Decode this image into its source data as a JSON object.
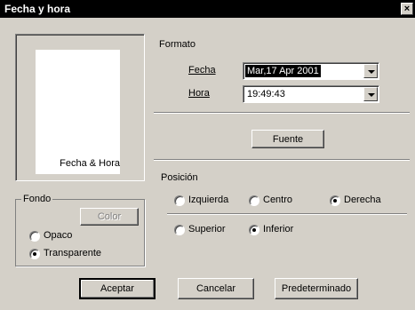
{
  "window": {
    "title": "Fecha y hora",
    "close_glyph": "×"
  },
  "preview": {
    "caption": "Fecha & Hora"
  },
  "fondo": {
    "label": "Fondo",
    "color_button": "Color",
    "options": [
      "Opaco",
      "Transparente"
    ],
    "selected": "Transparente"
  },
  "formato": {
    "label": "Formato",
    "fecha_label": "Fecha",
    "fecha_value": "Mar,17 Apr 2001",
    "hora_label": "Hora",
    "hora_value": "19:49:43",
    "fuente_button": "Fuente"
  },
  "posicion": {
    "label": "Posición",
    "horizontal": [
      "Izquierda",
      "Centro",
      "Derecha"
    ],
    "horizontal_selected": "Derecha",
    "vertical": [
      "Superior",
      "Inferior"
    ],
    "vertical_selected": "Inferior"
  },
  "buttons": {
    "accept": "Aceptar",
    "cancel": "Cancelar",
    "default": "Predeterminado"
  }
}
